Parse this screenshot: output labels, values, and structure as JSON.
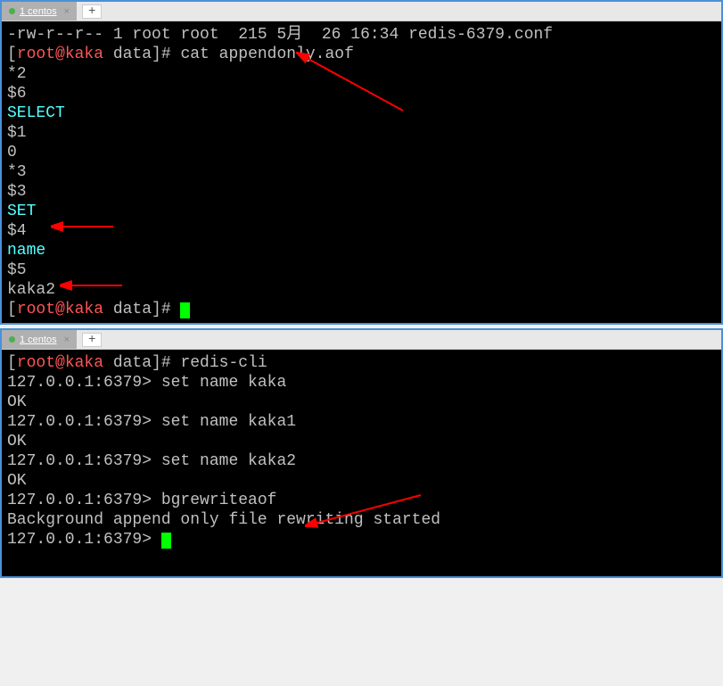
{
  "window1": {
    "tab": {
      "label": "1 centos",
      "close": "×",
      "add": "+"
    },
    "lines": {
      "l1_perms": "-rw-r--r--",
      "l1_rest": " 1 root root  215 5月  26 16:34 redis-6379.conf",
      "l2_prompt_open": "[",
      "l2_user": "root@kaka",
      "l2_path": " data",
      "l2_prompt_close": "]# ",
      "l2_cmd": "cat appendonly.aof",
      "l3": "*2",
      "l4": "$6",
      "l5": "SELECT",
      "l6": "$1",
      "l7": "0",
      "l8": "*3",
      "l9": "$3",
      "l10": "SET",
      "l11": "$4",
      "l12": "name",
      "l13": "$5",
      "l14": "kaka2",
      "l15_prompt_open": "[",
      "l15_user": "root@kaka",
      "l15_path": " data",
      "l15_prompt_close": "]# "
    }
  },
  "window2": {
    "tab": {
      "label": "1 centos",
      "close": "×",
      "add": "+"
    },
    "lines": {
      "l1_prompt_open": "[",
      "l1_user": "root@kaka",
      "l1_path": " data",
      "l1_prompt_close": "]# ",
      "l1_cmd": "redis-cli",
      "l2": "127.0.0.1:6379> set name kaka",
      "l3": "OK",
      "l4": "127.0.0.1:6379> set name kaka1",
      "l5": "OK",
      "l6": "127.0.0.1:6379> set name kaka2",
      "l7": "OK",
      "l8": "127.0.0.1:6379> bgrewriteaof",
      "l9": "Background append only file rewriting started",
      "l10": "127.0.0.1:6379> "
    }
  }
}
